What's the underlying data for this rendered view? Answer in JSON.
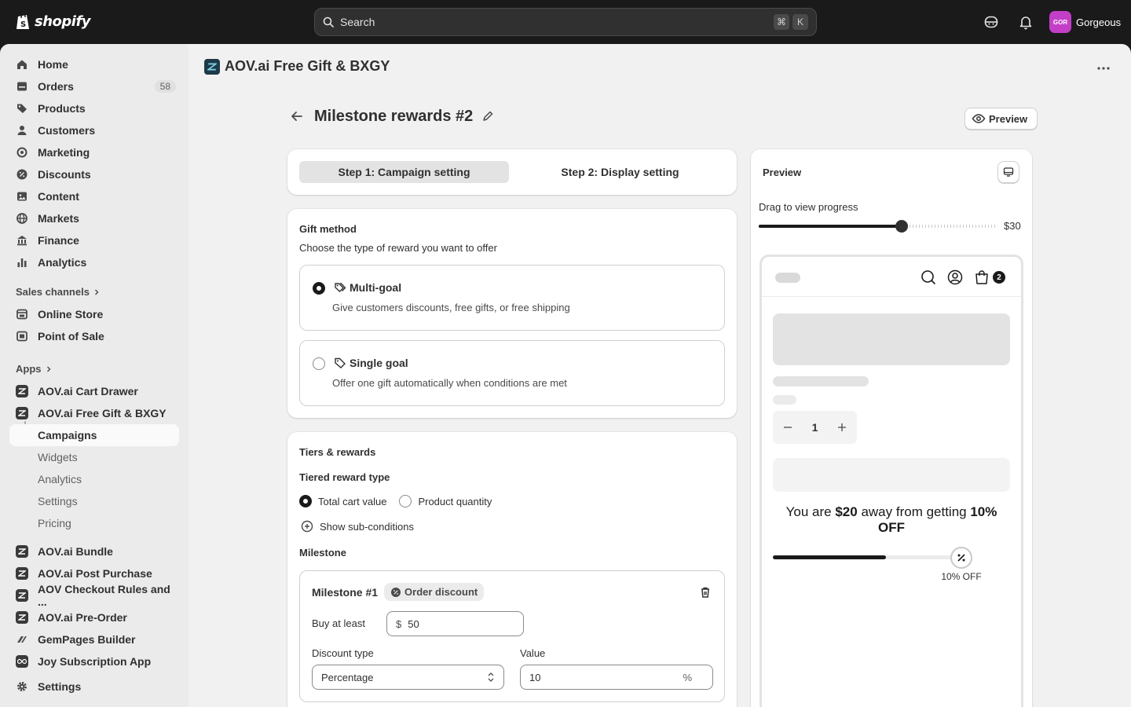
{
  "topbar": {
    "logo_text": "shopify",
    "search_placeholder": "Search",
    "kbd1": "⌘",
    "kbd2": "K",
    "store_initials": "GOR",
    "store_name": "Gorgeous"
  },
  "sidebar": {
    "items": [
      {
        "label": "Home",
        "icon": "home-icon"
      },
      {
        "label": "Orders",
        "icon": "orders-icon",
        "badge": "58"
      },
      {
        "label": "Products",
        "icon": "tag-icon"
      },
      {
        "label": "Customers",
        "icon": "person-icon"
      },
      {
        "label": "Marketing",
        "icon": "target-icon"
      },
      {
        "label": "Discounts",
        "icon": "discount-icon"
      },
      {
        "label": "Content",
        "icon": "content-icon"
      },
      {
        "label": "Markets",
        "icon": "globe-icon"
      },
      {
        "label": "Finance",
        "icon": "bank-icon"
      },
      {
        "label": "Analytics",
        "icon": "bar-chart-icon"
      }
    ],
    "sales_channels_label": "Sales channels",
    "channels": [
      {
        "label": "Online Store",
        "icon": "store-icon"
      },
      {
        "label": "Point of Sale",
        "icon": "pos-icon"
      }
    ],
    "apps_label": "Apps",
    "apps_top": [
      {
        "label": "AOV.ai Cart Drawer"
      },
      {
        "label": "AOV.ai Free Gift & BXGY"
      }
    ],
    "subitems": [
      {
        "label": "Campaigns"
      },
      {
        "label": "Widgets"
      },
      {
        "label": "Analytics"
      },
      {
        "label": "Settings"
      },
      {
        "label": "Pricing"
      }
    ],
    "apps_bottom": [
      {
        "label": "AOV.ai Bundle"
      },
      {
        "label": "AOV.ai Post Purchase"
      },
      {
        "label": "AOV Checkout Rules and ..."
      },
      {
        "label": "AOV.ai Pre-Order"
      },
      {
        "label": "GemPages Builder"
      },
      {
        "label": "Joy Subscription App"
      }
    ],
    "settings_label": "Settings"
  },
  "app_header": {
    "title": "AOV.ai Free Gift & BXGY"
  },
  "page": {
    "title": "Milestone rewards #2",
    "preview_button": "Preview"
  },
  "steps": {
    "step1": "Step 1: Campaign setting",
    "step2": "Step 2: Display setting"
  },
  "gift_method": {
    "title": "Gift method",
    "subtitle": "Choose the type of reward you want to offer",
    "options": [
      {
        "title": "Multi-goal",
        "desc": "Give customers discounts, free gifts, or free shipping",
        "selected": true
      },
      {
        "title": "Single goal",
        "desc": "Offer one gift automatically when conditions are met",
        "selected": false
      }
    ]
  },
  "tiers": {
    "title": "Tiers & rewards",
    "reward_type_label": "Tiered reward type",
    "opt_total": "Total cart value",
    "opt_qty": "Product quantity",
    "show_sub": "Show sub-conditions",
    "milestone_label": "Milestone",
    "milestone1": {
      "title": "Milestone #1",
      "chip": "Order discount",
      "buy_label": "Buy at least",
      "currency": "$",
      "buy_value": "50",
      "discount_type_label": "Discount type",
      "discount_type_value": "Percentage",
      "value_label": "Value",
      "value": "10",
      "value_suffix": "%"
    }
  },
  "preview": {
    "title": "Preview",
    "drag_label": "Drag to view progress",
    "slider_value": "$30",
    "slider_fraction": 0.6,
    "cart_count": "2",
    "qty": "1",
    "message_pre": "You are ",
    "message_amount": "$20",
    "message_mid": " away from getting ",
    "message_reward": "10% OFF",
    "progress_fraction": 0.6,
    "milestone_label": "10% OFF"
  }
}
